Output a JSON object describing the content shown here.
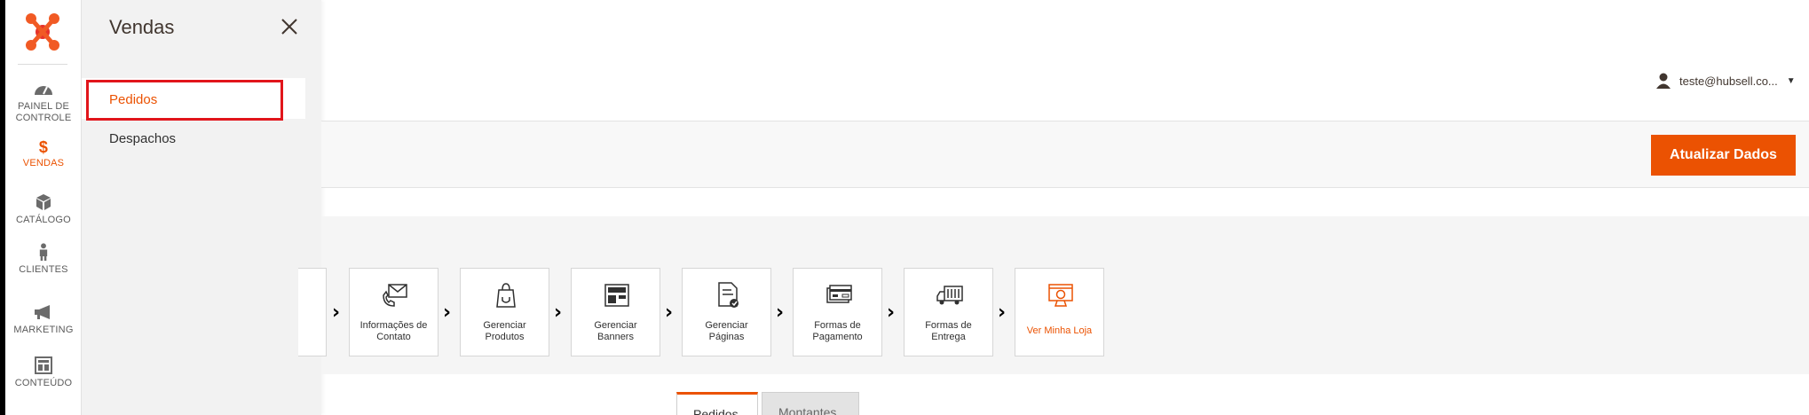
{
  "rail": {
    "items": [
      {
        "line1": "PAINEL DE",
        "line2": "CONTROLE",
        "icon": "dashboard-icon"
      },
      {
        "line1": "$",
        "line2": "VENDAS",
        "icon": "dollar-icon"
      },
      {
        "line1": "",
        "line2": "CATÁLOGO",
        "icon": "box-icon"
      },
      {
        "line1": "",
        "line2": "CLIENTES",
        "icon": "person-icon"
      },
      {
        "line1": "",
        "line2": "MARKETING",
        "icon": "megaphone-icon"
      },
      {
        "line1": "",
        "line2": "CONTEÚDO",
        "icon": "layout-icon"
      }
    ]
  },
  "flyout": {
    "title": "Vendas",
    "items": [
      {
        "label": "Pedidos"
      },
      {
        "label": "Despachos"
      }
    ]
  },
  "header": {
    "user": "teste@hubsell.co..."
  },
  "actions": {
    "update_label": "Atualizar Dados"
  },
  "steps": [
    {
      "line1": "Informações de",
      "line2": "Contato",
      "icon": "envelope-phone-icon"
    },
    {
      "line1": "Gerenciar",
      "line2": "Produtos",
      "icon": "bag-icon"
    },
    {
      "line1": "Gerenciar",
      "line2": "Banners",
      "icon": "banner-icon"
    },
    {
      "line1": "Gerenciar",
      "line2": "Páginas",
      "icon": "page-icon"
    },
    {
      "line1": "Formas de",
      "line2": "Pagamento",
      "icon": "card-icon"
    },
    {
      "line1": "Formas de",
      "line2": "Entrega",
      "icon": "truck-icon"
    },
    {
      "line1": "Ver Minha Loja",
      "line2": "",
      "icon": "store-icon"
    }
  ],
  "tabs": [
    {
      "label": "Pedidos"
    },
    {
      "label": "Montantes"
    }
  ],
  "colors": {
    "accent": "#eb5202",
    "highlight": "#e1151b"
  }
}
